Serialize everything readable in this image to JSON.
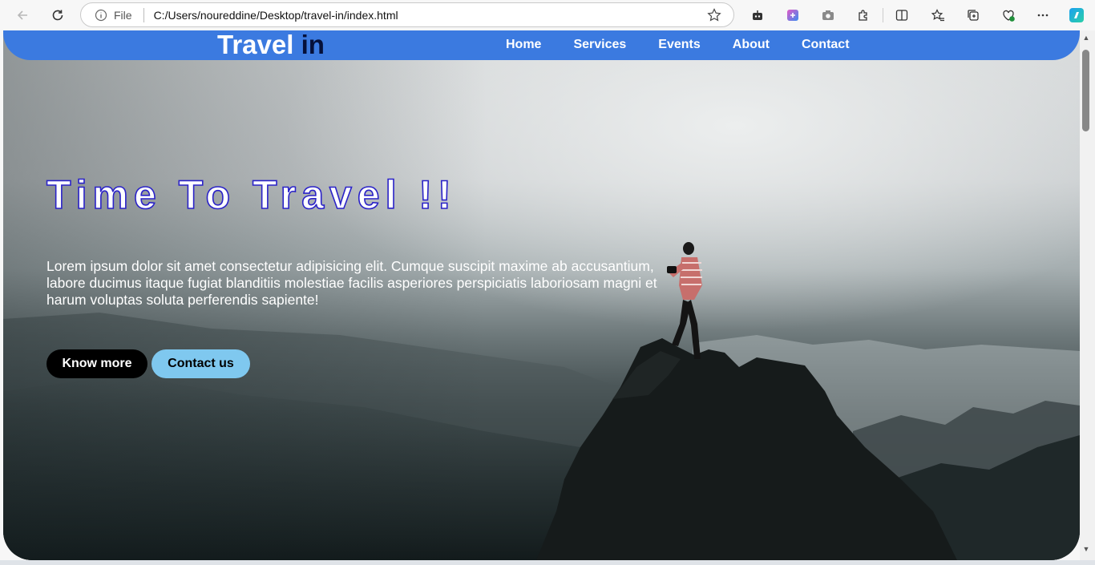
{
  "browser": {
    "site_info": "File",
    "url": "C:/Users/noureddine/Desktop/travel-in/index.html"
  },
  "header": {
    "logo_part1": "Travel",
    "logo_part2": "in",
    "nav": [
      "Home",
      "Services",
      "Events",
      "About",
      "Contact"
    ],
    "color": "#3b7ae0"
  },
  "hero": {
    "headline": "Time To Travel !!",
    "lead": "Lorem ipsum dolor sit amet consectetur adipisicing elit. Cumque suscipit maxime ab accusantium, labore ducimus itaque fugiat blanditiis molestiae facilis asperiores perspiciatis laboriosam magni et harum voluptas soluta perferendis sapiente!",
    "btn_primary": "Know more",
    "btn_secondary": "Contact us"
  },
  "colors": {
    "accent": "#3b7ae0",
    "logo_dark": "#05103a",
    "headline_stroke": "#2a22c8",
    "contact_btn": "#7fc8ef"
  }
}
